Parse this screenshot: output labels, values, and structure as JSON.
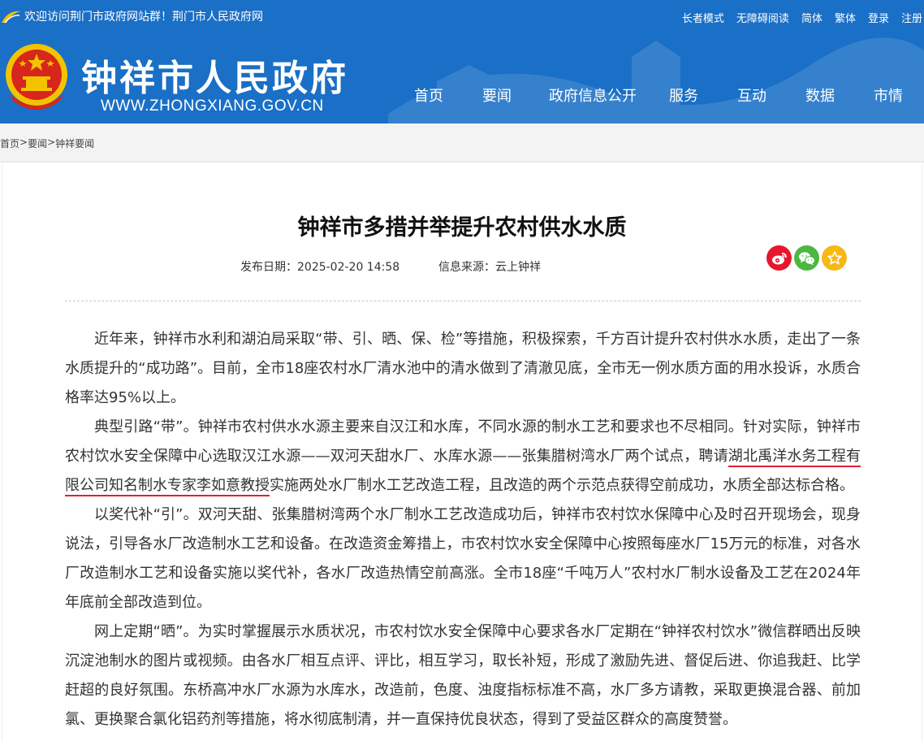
{
  "header": {
    "welcome": "欢迎访问荆门市政府网站群！荆门市人民政府网",
    "toplinks": [
      "长者模式",
      "无障碍阅读",
      "简体",
      "繁体",
      "登录",
      "注册"
    ],
    "site_title": "钟祥市人民政府",
    "site_url": "WWW.ZHONGXIANG.GOV.CN",
    "nav": [
      "首页",
      "要闻",
      "政府信息公开",
      "服务",
      "互动",
      "数据",
      "市情"
    ]
  },
  "breadcrumb": {
    "items": [
      "首页",
      "要闻",
      "钟祥要闻"
    ],
    "separator": ">"
  },
  "article": {
    "title": "钟祥市多措并举提升农村供水水质",
    "date": "发布日期：2025-02-20 14:58",
    "source": "信息来源：云上钟祥",
    "p1": "近年来，钟祥市水利和湖泊局采取“带、引、晒、保、检”等措施，积极探索，千方百计提升农村供水水质，走出了一条水质提升的“成功路”。目前，全市18座农村水厂清水池中的清水做到了清澈见底，全市无一例水质方面的用水投诉，水质合格率达95%以上。",
    "p2_before": "典型引路“带”。钟祥市农村供水水源主要来自汉江和水库，不同水源的制水工艺和要求也不尽相同。针对实际，钟祥市农村饮水安全保障中心选取汉江水源——双河天甜水厂、水库水源——张集腊树湾水厂两个试点，聘请",
    "p2_hl1": "湖北禹洋水务工程有",
    "p2_hl2": "限公司知名制水专家李如意教授",
    "p2_after": "实施两处水厂制水工艺改造工程，且改造的两个示范点获得空前成功，水质全部达标合格。",
    "p3": "以奖代补“引”。双河天甜、张集腊树湾两个水厂制水工艺改造成功后，钟祥市农村饮水保障中心及时召开现场会，现身说法，引导各水厂改造制水工艺和设备。在改造资金筹措上，市农村饮水安全保障中心按照每座水厂15万元的标准，对各水厂改造制水工艺和设备实施以奖代补，各水厂改造热情空前高涨。全市18座“千吨万人”农村水厂制水设备及工艺在2024年年底前全部改造到位。",
    "p4": "网上定期“晒”。为实时掌握展示水质状况，市农村饮水安全保障中心要求各水厂定期在“钟祥农村饮水”微信群晒出反映沉淀池制水的图片或视频。由各水厂相互点评、评比，相互学习，取长补短，形成了激励先进、督促后进、你追我赶、比学赶超的良好氛围。东桥高冲水厂水源为水库水，改造前，色度、浊度指标标准不高，水厂多方请教，采取更换混合器、前加氯、更换聚合氯化铝药剂等措施，将水彻底制清，并一直保持优良状态，得到了受益区群众的高度赞誉。"
  },
  "share_icons": [
    "weibo-icon",
    "wechat-icon",
    "favorite-star-icon"
  ],
  "colors": {
    "header_blue": "#1a6fc6",
    "highlight_underline": "#e02030",
    "weibo": "#e6162d",
    "wechat": "#4cb641",
    "favorite": "#f5b814"
  }
}
